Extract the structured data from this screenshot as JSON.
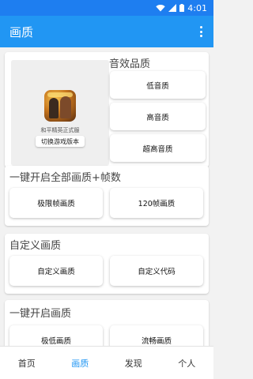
{
  "status_bar": {
    "time": "4:01"
  },
  "app_bar": {
    "title": "画质"
  },
  "game": {
    "name": "和平精英正式服",
    "switch_label": "切换游戏版本"
  },
  "audio_section": {
    "title": "音效品质",
    "options": [
      "低音质",
      "高音质",
      "超高音质"
    ]
  },
  "all_quality_section": {
    "title": "一键开启全部画质+帧数",
    "options": [
      "极限帧画质",
      "120帧画质"
    ]
  },
  "custom_section": {
    "title": "自定义画质",
    "options": [
      "自定义画质",
      "自定义代码"
    ]
  },
  "quick_section": {
    "title": "一键开启画质",
    "options": [
      "极低画质",
      "流畅画质"
    ]
  },
  "bottom_nav": {
    "items": [
      "首页",
      "画质",
      "发现",
      "个人"
    ],
    "active_index": 1,
    "active_color": "#2196f3"
  },
  "colors": {
    "app_bar": "#2196f3",
    "status_bar": "#1e7ef0"
  }
}
